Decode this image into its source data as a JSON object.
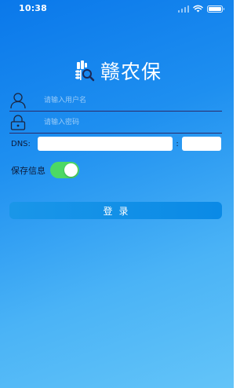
{
  "status_bar": {
    "time": "10:38"
  },
  "app": {
    "title": "赣农保"
  },
  "login_form": {
    "username_placeholder": "请输入用户名",
    "password_placeholder": "请输入密码",
    "dns_label": "DNS:",
    "dns_separator": ":",
    "dns_host_value": "",
    "dns_port_value": "",
    "save_info_label": "保存信息",
    "save_info_enabled": true,
    "login_button_label": "登录"
  },
  "icons": {
    "logo": "wheat-magnifier-logo-icon",
    "username": "user-icon",
    "password": "lock-icon",
    "signal": "cellular-signal-icon",
    "wifi": "wifi-icon",
    "battery": "battery-icon"
  },
  "colors": {
    "background_start": "#0a78ea",
    "background_end": "#63c4f8",
    "toggle_on": "#4cd964",
    "field_underline": "#2b2b6a"
  }
}
